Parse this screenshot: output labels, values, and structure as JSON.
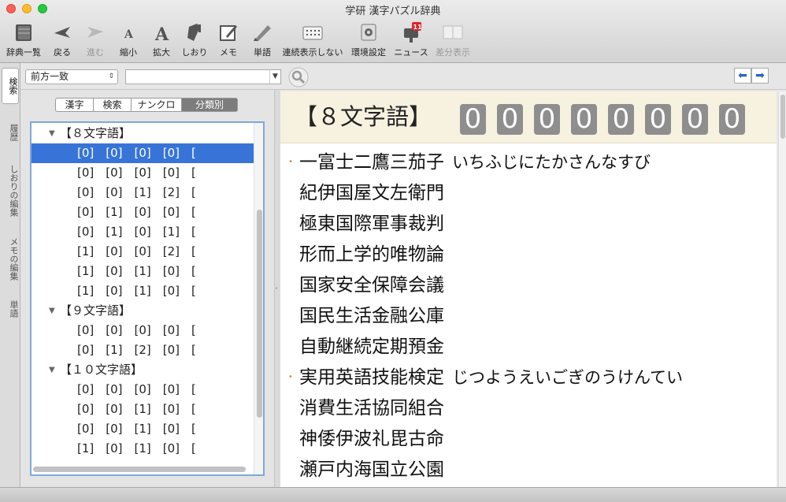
{
  "window": {
    "title": "学研 漢字パズル辞典"
  },
  "toolbar": {
    "items": [
      {
        "label": "辞典一覧",
        "icon": "book-stack-icon"
      },
      {
        "label": "戻る",
        "icon": "back-arrow-icon"
      },
      {
        "label": "進む",
        "icon": "forward-arrow-icon"
      },
      {
        "label": "縮小",
        "icon": "font-smaller-icon"
      },
      {
        "label": "拡大",
        "icon": "font-larger-icon"
      },
      {
        "label": "しおり",
        "icon": "bookmark-icon"
      },
      {
        "label": "メモ",
        "icon": "memo-pencil-icon"
      },
      {
        "label": "単語",
        "icon": "word-pen-icon"
      },
      {
        "label": "連続表示しない",
        "icon": "continuous-grid-icon"
      },
      {
        "label": "環境設定",
        "icon": "settings-icon"
      },
      {
        "label": "ニュース",
        "icon": "news-mailbox-icon",
        "badge": "11"
      },
      {
        "label": "差分表示",
        "icon": "diff-panel-icon"
      }
    ]
  },
  "search": {
    "mode": "前方一致",
    "query": ""
  },
  "side_tabs": {
    "search": "検索",
    "history": "履歴",
    "bookmark_edit": "しおりの編集",
    "memo_edit": "メモの編集",
    "words": "単語"
  },
  "segments": {
    "kanji": "漢字",
    "search": "検索",
    "nankuro": "ナンクロ",
    "category": "分類別"
  },
  "tree": [
    {
      "kind": "group",
      "text": "【８文字語】"
    },
    {
      "kind": "item",
      "text": "[0]　[0]　[0]　[0]　[",
      "selected": true
    },
    {
      "kind": "item",
      "text": "[0]　[0]　[0]　[0]　["
    },
    {
      "kind": "item",
      "text": "[0]　[0]　[1]　[2]　["
    },
    {
      "kind": "item",
      "text": "[0]　[1]　[0]　[0]　["
    },
    {
      "kind": "item",
      "text": "[0]　[1]　[0]　[1]　["
    },
    {
      "kind": "item",
      "text": "[1]　[0]　[0]　[2]　["
    },
    {
      "kind": "item",
      "text": "[1]　[0]　[1]　[0]　["
    },
    {
      "kind": "item",
      "text": "[1]　[0]　[1]　[0]　["
    },
    {
      "kind": "group",
      "text": "【９文字語】"
    },
    {
      "kind": "item",
      "text": "[0]　[0]　[0]　[0]　["
    },
    {
      "kind": "item",
      "text": "[0]　[1]　[2]　[0]　["
    },
    {
      "kind": "group",
      "text": "【１０文字語】"
    },
    {
      "kind": "item",
      "text": "[0]　[0]　[0]　[0]　["
    },
    {
      "kind": "item",
      "text": "[0]　[0]　[1]　[0]　["
    },
    {
      "kind": "item",
      "text": "[0]　[0]　[1]　[0]　["
    },
    {
      "kind": "item",
      "text": "[1]　[0]　[1]　[0]　["
    }
  ],
  "content": {
    "heading": "【８文字語】",
    "digits": [
      "0",
      "0",
      "0",
      "0",
      "0",
      "0",
      "0",
      "0"
    ],
    "entries": [
      {
        "word": "一富士二鷹三茄子",
        "reading": "いちふじにたかさんなすび",
        "marked": true
      },
      {
        "word": "紀伊国屋文左衛門",
        "reading": "",
        "marked": false
      },
      {
        "word": "極東国際軍事裁判",
        "reading": "",
        "marked": false
      },
      {
        "word": "形而上学的唯物論",
        "reading": "",
        "marked": false
      },
      {
        "word": "国家安全保障会議",
        "reading": "",
        "marked": false
      },
      {
        "word": "国民生活金融公庫",
        "reading": "",
        "marked": false
      },
      {
        "word": "自動継続定期預金",
        "reading": "",
        "marked": false
      },
      {
        "word": "実用英語技能検定",
        "reading": "じつようえいごぎのうけんてい",
        "marked": true
      },
      {
        "word": "消費生活協同組合",
        "reading": "",
        "marked": false
      },
      {
        "word": "神倭伊波礼毘古命",
        "reading": "",
        "marked": false
      },
      {
        "word": "瀬戸内海国立公園",
        "reading": "",
        "marked": false
      }
    ]
  },
  "colors": {
    "selection": "#3874d8",
    "header_bg": "#f7f1e0",
    "digit_bg": "#8e8e8e",
    "tree_border": "#7fa9d8",
    "bullet": "#e08050"
  }
}
